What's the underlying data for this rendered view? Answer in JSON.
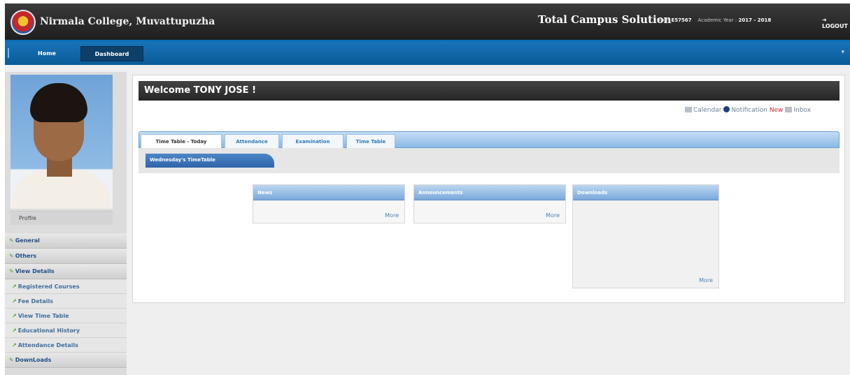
{
  "header": {
    "college_name": "Nirmala College, Muvattupuzha",
    "app_name": "Total Campus Solution",
    "user_label": "User:",
    "user_id": "E57567",
    "year_label": "Academic Year :",
    "academic_year": "2017 - 2018",
    "logout_label": "LOGOUT"
  },
  "nav": {
    "home": "Home",
    "dashboard": "Dashboard"
  },
  "sidebar": {
    "profile_label": "Profile",
    "menu": [
      {
        "label": "General",
        "kind": "head"
      },
      {
        "label": "Others",
        "kind": "head"
      },
      {
        "label": "View Details",
        "kind": "head"
      },
      {
        "label": "Registered Courses",
        "kind": "sub"
      },
      {
        "label": "Fee Details",
        "kind": "sub"
      },
      {
        "label": "View Time Table",
        "kind": "sub"
      },
      {
        "label": "Educational History",
        "kind": "sub"
      },
      {
        "label": "Attendance Details",
        "kind": "sub"
      },
      {
        "label": "DownLoads",
        "kind": "head"
      }
    ]
  },
  "main": {
    "welcome": "Welcome TONY JOSE  !",
    "links": {
      "calendar": "Calendar",
      "notification": "Notification",
      "new": "New",
      "inbox": "Inbox"
    },
    "tabs": [
      "Time Table - Today",
      "Attendance",
      "Examination",
      "Time Table"
    ],
    "timetable_label": "Wednesday's TimeTable",
    "boxes": {
      "news": {
        "title": "News",
        "more": "More"
      },
      "announcements": {
        "title": "Announcements",
        "more": "More"
      },
      "downloads": {
        "title": "Downloads",
        "more": "More"
      }
    }
  },
  "colors": {
    "header_bg": "#2a2a2a",
    "nav_bg": "#1170b0",
    "accent_blue": "#4d86c7",
    "new_red": "#d82828"
  }
}
